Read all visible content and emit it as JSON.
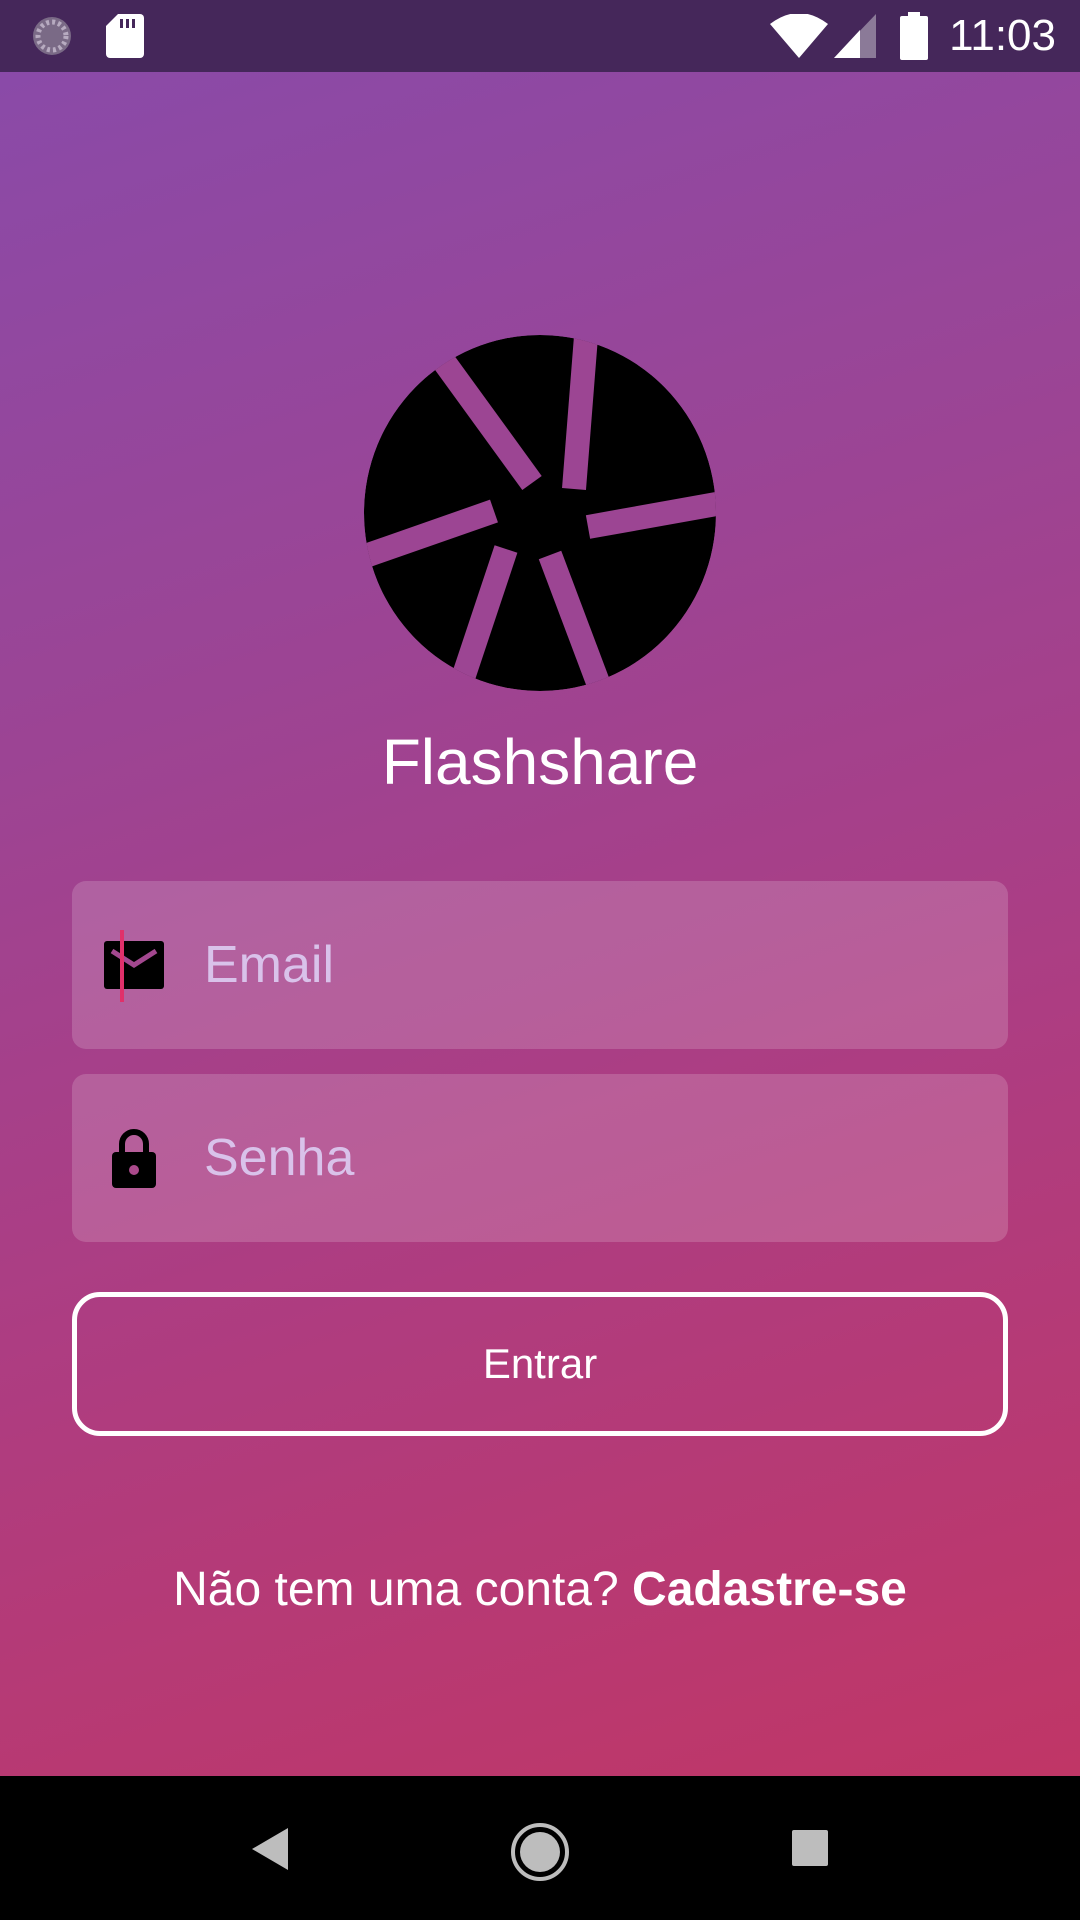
{
  "status_bar": {
    "time": "11:03",
    "icons": [
      "loading-icon",
      "sd-card-icon",
      "wifi-icon",
      "cell-signal-icon",
      "battery-icon"
    ]
  },
  "app": {
    "title": "Flashshare",
    "logo_icon": "camera-aperture-icon"
  },
  "form": {
    "email": {
      "placeholder": "Email",
      "value": "",
      "icon": "mail-icon"
    },
    "password": {
      "placeholder": "Senha",
      "value": "",
      "icon": "lock-icon"
    },
    "submit_label": "Entrar"
  },
  "signup": {
    "prompt": "Não tem uma conta?",
    "link": "Cadastre-se"
  },
  "nav_bar": {
    "buttons": [
      "back-icon",
      "home-icon",
      "recents-icon"
    ]
  },
  "colors": {
    "gradient_start": "#8a4aa8",
    "gradient_end": "#c03666",
    "status_bar": "#45275a",
    "caret": "#e0306a",
    "placeholder": "#d9c2ea"
  }
}
